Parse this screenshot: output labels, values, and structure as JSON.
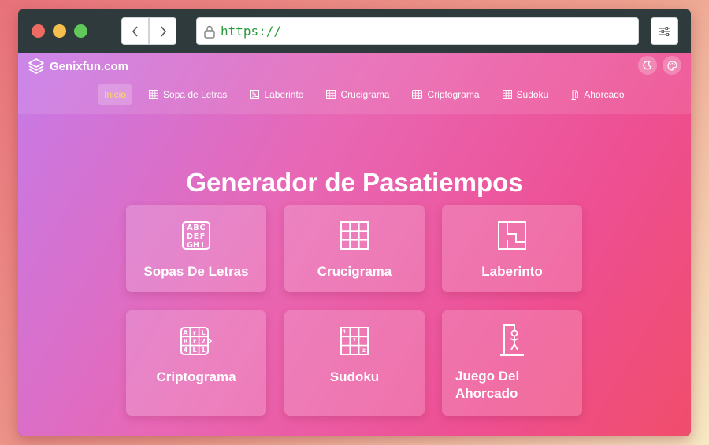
{
  "browser": {
    "url": "https://"
  },
  "site": {
    "brand": "Genixfun.com",
    "nav": [
      {
        "label": "Inicio",
        "icon": "none",
        "active": true
      },
      {
        "label": "Sopa de Letras",
        "icon": "grid-icon"
      },
      {
        "label": "Laberinto",
        "icon": "maze-icon"
      },
      {
        "label": "Crucigrama",
        "icon": "grid-icon"
      },
      {
        "label": "Criptograma",
        "icon": "grid-icon"
      },
      {
        "label": "Sudoku",
        "icon": "grid-icon"
      },
      {
        "label": "Ahorcado",
        "icon": "gallows-icon"
      }
    ]
  },
  "main": {
    "title": "Generador de Pasatiempos",
    "cards": [
      {
        "label": "Sopas De Letras",
        "icon": "letters-grid-icon"
      },
      {
        "label": "Crucigrama",
        "icon": "crossword-icon"
      },
      {
        "label": "Laberinto",
        "icon": "maze-icon"
      },
      {
        "label": "Criptograma",
        "icon": "cryptogram-icon"
      },
      {
        "label": "Sudoku",
        "icon": "sudoku-icon"
      },
      {
        "label": "Juego Del Ahorcado",
        "icon": "hangman-icon"
      }
    ]
  },
  "colors": {
    "accent_active": "#ffd95e",
    "url_text": "#2a9a3a",
    "window_chrome": "#2f3a3d"
  }
}
